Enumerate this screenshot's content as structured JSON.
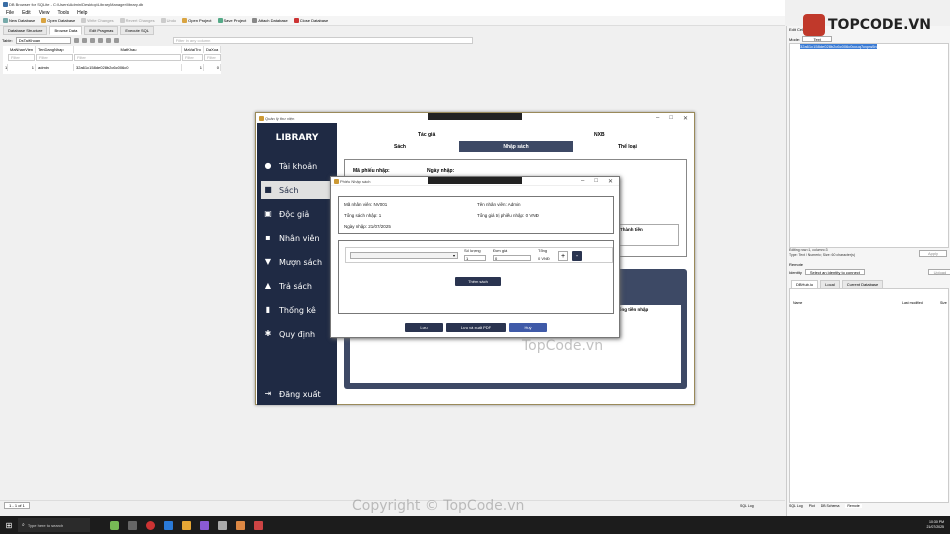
{
  "db_app": {
    "title": "DB Browser for SQLite - C:\\Users\\Admin\\Desktop\\LibraryManager\\library.db",
    "menus": [
      "File",
      "Edit",
      "View",
      "Tools",
      "Help"
    ],
    "toolbar": {
      "new_db": "New Database",
      "open_db": "Open Database",
      "write": "Write Changes",
      "revert": "Revert Changes",
      "undo": "Undo",
      "open_project": "Open Project",
      "save_project": "Save Project",
      "attach": "Attach Database",
      "close": "Close Database"
    },
    "tabs": [
      "Database Structure",
      "Browse Data",
      "Edit Pragmas",
      "Execute SQL"
    ],
    "table_label": "Table:",
    "table_value": "DsTaiKhoan",
    "filter_placeholder": "Filter in any column",
    "columns": [
      "MaNhanVien",
      "TenDangNhap",
      "MatKhau",
      "MaVaiTro",
      "DaXoa"
    ],
    "filter_text": "Filter",
    "row": {
      "num": "1",
      "c1": "1",
      "c2": "admin",
      "c3": "32a61c158de028b2c6c006c0",
      "c4": "1",
      "c5": "0"
    },
    "status_page": "1 - 1 of 1",
    "bottom_tabs": [
      "SQL Log",
      "Plot",
      "DB Schema",
      "Remote"
    ]
  },
  "right_pane": {
    "edit_cell": "Edit Cell",
    "mode_label": "Mode:",
    "mode_value": "Text",
    "cell_text": "32a61c158de028b2c6c006c0ccuq7cvpw5n",
    "editing_info": "Editing row=1, column=3",
    "type_info": "Type: Text / Numeric; Size: 60 character(s)",
    "apply": "Apply",
    "remote": "Remote",
    "identity_label": "Identity",
    "identity_value": "Select an identity to connect",
    "upload": "Upload",
    "remote_tabs": [
      "DBHub.io",
      "Local",
      "Current Database"
    ],
    "remote_cols": [
      "Name",
      "Last modified",
      "Size"
    ]
  },
  "library_app": {
    "window_title": "Quản lý thư viện",
    "logo": "LIBRARY",
    "sidebar": [
      "Tài khoản",
      "Sách",
      "Độc giả",
      "Nhân viên",
      "Mượn sách",
      "Trả sách",
      "Thống kê",
      "Quy định",
      "Đăng xuất"
    ],
    "top_tabs_row1": [
      "Tác giả",
      "NXB"
    ],
    "top_tabs_row2": [
      "Sách",
      "Nhập sách",
      "Thể loại"
    ],
    "form_labels": [
      "Mã phiếu nhập:",
      "Ngày nhập:"
    ],
    "table_headers": [
      "Thành tiền",
      "Tổng tiền nhập"
    ]
  },
  "dialog": {
    "title": "Phiếu Nhập sách",
    "staff_id_label": "Mã nhân viên:",
    "staff_id": "NV001",
    "staff_name_label": "Tên nhân viên:",
    "staff_name": "Admin",
    "total_books_label": "Tổng sách nhập:",
    "total_books": "1",
    "total_value_label": "Tổng giá trị phiếu nhập:",
    "total_value": "0 VNĐ",
    "date_label": "Ngày nhập:",
    "date": "21/07/2025",
    "qty_label": "Số lượng",
    "qty": "1",
    "price_label": "Đơn giá",
    "price": "0",
    "sum_label": "Tổng",
    "sum": "0 VNĐ",
    "plus": "+",
    "minus": "-",
    "add_book": "Thêm sách",
    "save": "Lưu",
    "save_export": "Lưu và xuất PDF",
    "cancel": "Huỷ"
  },
  "taskbar": {
    "search": "Type here to search",
    "time": "10:30 PM",
    "date": "21/07/2025"
  },
  "watermarks": {
    "logo": "TOPCODE.VN",
    "mid": "TopCode.vn",
    "bottom": "Copyright © TopCode.vn"
  }
}
